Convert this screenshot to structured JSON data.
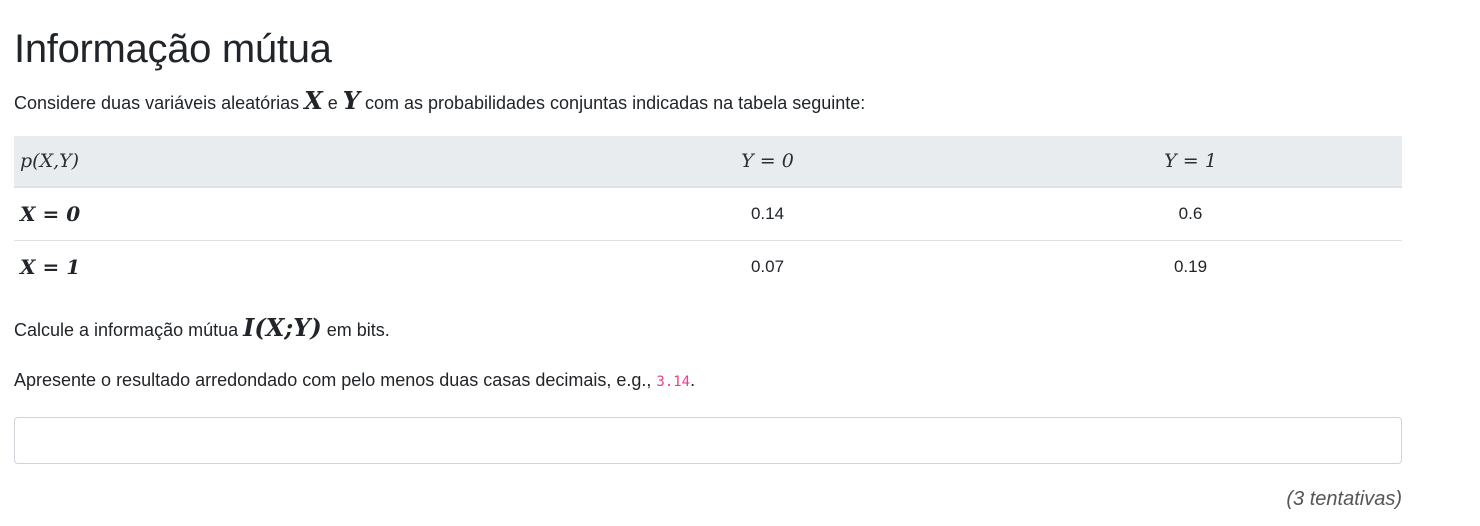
{
  "page": {
    "title": "Informação mútua",
    "intro": {
      "before": "Considere duas variáveis aleatórias ",
      "var_x": "X",
      "conj": " e ",
      "var_y": "Y",
      "after": " com as probabilidades conjuntas indicadas na tabela seguinte:"
    },
    "table": {
      "header": [
        "p(X,Y)",
        "Y = 0",
        "Y = 1"
      ],
      "rows": [
        {
          "label": "X = 0",
          "values": [
            "0.14",
            "0.6"
          ]
        },
        {
          "label": "X = 1",
          "values": [
            "0.07",
            "0.19"
          ]
        }
      ]
    },
    "question": {
      "before": "Calcule a informação mútua ",
      "expr": "I(X;Y)",
      "after": " em bits."
    },
    "instruction": {
      "before": "Apresente o resultado arredondado com pelo menos duas casas decimais, e.g., ",
      "example": "3.14",
      "after": "."
    },
    "answer": {
      "value": "",
      "placeholder": ""
    },
    "attempts": "(3 tentativas)"
  }
}
